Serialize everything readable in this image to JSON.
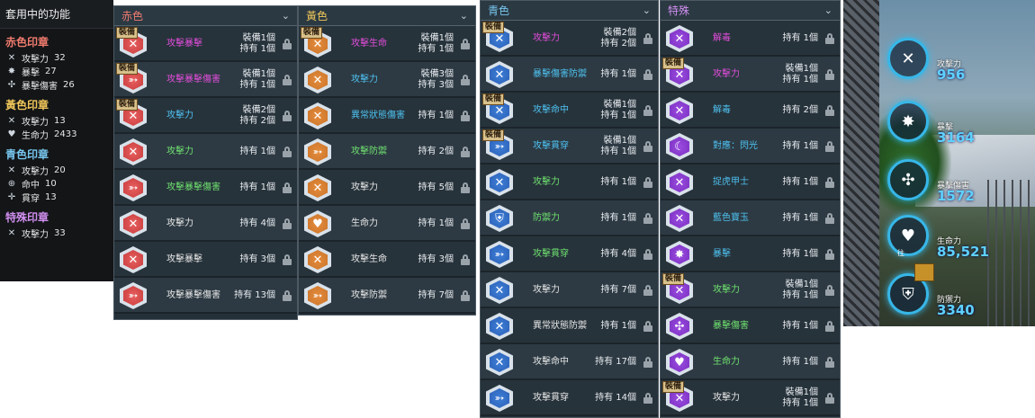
{
  "summary": {
    "title": "套用中的功能",
    "groups": [
      {
        "name": "赤色印章",
        "color": "#f07b6e",
        "items": [
          {
            "icon": "crossed-swords-icon",
            "glyph": "✕",
            "name": "攻擊力",
            "value": "32"
          },
          {
            "icon": "burst-icon",
            "glyph": "✸",
            "name": "暴擊",
            "value": "27"
          },
          {
            "icon": "crit-damage-icon",
            "glyph": "✣",
            "name": "暴擊傷害",
            "value": "26"
          }
        ]
      },
      {
        "name": "黃色印章",
        "color": "#f1c75a",
        "items": [
          {
            "icon": "crossed-swords-icon",
            "glyph": "✕",
            "name": "攻擊力",
            "value": "13"
          },
          {
            "icon": "heart-icon",
            "glyph": "♥",
            "name": "生命力",
            "value": "2433"
          }
        ]
      },
      {
        "name": "青色印章",
        "color": "#77c6ee",
        "items": [
          {
            "icon": "crossed-swords-icon",
            "glyph": "✕",
            "name": "攻擊力",
            "value": "20"
          },
          {
            "icon": "crosshair-icon",
            "glyph": "⊕",
            "name": "命中",
            "value": "10"
          },
          {
            "icon": "pierce-icon",
            "glyph": "✛",
            "name": "貫穿",
            "value": "13"
          }
        ]
      },
      {
        "name": "特殊印章",
        "color": "#d18ff0",
        "items": [
          {
            "icon": "crossed-swords-icon",
            "glyph": "✕",
            "name": "攻擊力",
            "value": "33"
          }
        ]
      }
    ]
  },
  "columns": [
    {
      "title": "赤色",
      "title_color": "#f07b6e",
      "gem_color": "#c73b3b",
      "gem_inner": "#e86060",
      "rows": [
        {
          "equipped": true,
          "name": "攻擊暴擊",
          "name_color": "#e24ddb",
          "equip": "裝備1個",
          "own": "持有 1個",
          "glyph": "✕"
        },
        {
          "equipped": true,
          "name": "攻擊暴擊傷害",
          "name_color": "#e24ddb",
          "equip": "裝備1個",
          "own": "持有 1個",
          "glyph": "➳"
        },
        {
          "equipped": true,
          "name": "攻擊力",
          "name_color": "#4ec1f0",
          "equip": "裝備2個",
          "own": "持有 2個",
          "glyph": "✕"
        },
        {
          "equipped": false,
          "name": "攻擊力",
          "name_color": "#6fe06f",
          "equip": "",
          "own": "持有 1個",
          "glyph": "✕"
        },
        {
          "equipped": false,
          "name": "攻擊暴擊傷害",
          "name_color": "#6fe06f",
          "equip": "",
          "own": "持有 1個",
          "glyph": "➳"
        },
        {
          "equipped": false,
          "name": "攻擊力",
          "name_color": "#e6e6e6",
          "equip": "",
          "own": "持有 4個",
          "glyph": "✕"
        },
        {
          "equipped": false,
          "name": "攻擊暴擊",
          "name_color": "#e6e6e6",
          "equip": "",
          "own": "持有 3個",
          "glyph": "✕"
        },
        {
          "equipped": false,
          "name": "攻擊暴擊傷害",
          "name_color": "#e6e6e6",
          "equip": "",
          "own": "持有 13個",
          "glyph": "➳"
        }
      ]
    },
    {
      "title": "黃色",
      "title_color": "#f1c75a",
      "gem_color": "#c9742a",
      "gem_inner": "#e58c3c",
      "rows": [
        {
          "equipped": true,
          "name": "攻擊生命",
          "name_color": "#e24ddb",
          "equip": "裝備1個",
          "own": "持有 1個",
          "glyph": "✕"
        },
        {
          "equipped": false,
          "name": "攻擊力",
          "name_color": "#4ec1f0",
          "equip": "裝備3個",
          "own": "持有 3個",
          "glyph": "✕"
        },
        {
          "equipped": false,
          "name": "異常狀態傷害",
          "name_color": "#4ec1f0",
          "equip": "",
          "own": "持有 1個",
          "glyph": "✕"
        },
        {
          "equipped": false,
          "name": "攻擊防禦",
          "name_color": "#6fe06f",
          "equip": "",
          "own": "持有 2個",
          "glyph": "➳"
        },
        {
          "equipped": false,
          "name": "攻擊力",
          "name_color": "#e6e6e6",
          "equip": "",
          "own": "持有 5個",
          "glyph": "✕"
        },
        {
          "equipped": false,
          "name": "生命力",
          "name_color": "#e6e6e6",
          "equip": "",
          "own": "持有 1個",
          "glyph": "♥"
        },
        {
          "equipped": false,
          "name": "攻擊生命",
          "name_color": "#e6e6e6",
          "equip": "",
          "own": "持有 3個",
          "glyph": "✕"
        },
        {
          "equipped": false,
          "name": "攻擊防禦",
          "name_color": "#e6e6e6",
          "equip": "",
          "own": "持有 7個",
          "glyph": "➳"
        }
      ]
    },
    {
      "title": "青色",
      "title_color": "#77c6ee",
      "gem_color": "#2a5fb5",
      "gem_inner": "#3f7fd8",
      "rows": [
        {
          "equipped": true,
          "name": "攻擊力",
          "name_color": "#e24ddb",
          "equip": "裝備2個",
          "own": "持有 2個",
          "glyph": "✕"
        },
        {
          "equipped": false,
          "name": "暴擊傷害防禦",
          "name_color": "#4ec1f0",
          "equip": "",
          "own": "持有 1個",
          "glyph": "✕"
        },
        {
          "equipped": true,
          "name": "攻擊命中",
          "name_color": "#4ec1f0",
          "equip": "裝備1個",
          "own": "持有 1個",
          "glyph": "✕"
        },
        {
          "equipped": true,
          "name": "攻擊貫穿",
          "name_color": "#4ec1f0",
          "equip": "裝備1個",
          "own": "持有 1個",
          "glyph": "➳"
        },
        {
          "equipped": false,
          "name": "攻擊力",
          "name_color": "#6fe06f",
          "equip": "",
          "own": "持有 1個",
          "glyph": "✕"
        },
        {
          "equipped": false,
          "name": "防禦力",
          "name_color": "#6fe06f",
          "equip": "",
          "own": "持有 1個",
          "glyph": "⛨"
        },
        {
          "equipped": false,
          "name": "攻擊貫穿",
          "name_color": "#6fe06f",
          "equip": "",
          "own": "持有 4個",
          "glyph": "➳"
        },
        {
          "equipped": false,
          "name": "攻擊力",
          "name_color": "#e6e6e6",
          "equip": "",
          "own": "持有 7個",
          "glyph": "✕"
        },
        {
          "equipped": false,
          "name": "異常狀態防禦",
          "name_color": "#e6e6e6",
          "equip": "",
          "own": "持有 1個",
          "glyph": "✕"
        },
        {
          "equipped": false,
          "name": "攻擊命中",
          "name_color": "#e6e6e6",
          "equip": "",
          "own": "持有 17個",
          "glyph": "✕"
        },
        {
          "equipped": false,
          "name": "攻擊貫穿",
          "name_color": "#e6e6e6",
          "equip": "",
          "own": "持有 14個",
          "glyph": "➳"
        }
      ]
    },
    {
      "title": "特殊",
      "title_color": "#d18ff0",
      "gem_color": "#7a2fc0",
      "gem_inner": "#9a4ce0",
      "rows": [
        {
          "equipped": false,
          "name": "解毒",
          "name_color": "#e24ddb",
          "equip": "",
          "own": "持有 1個",
          "glyph": "✕"
        },
        {
          "equipped": true,
          "name": "攻擊力",
          "name_color": "#e24ddb",
          "equip": "裝備1個",
          "own": "持有 1個",
          "glyph": "✕"
        },
        {
          "equipped": false,
          "name": "解毒",
          "name_color": "#4ec1f0",
          "equip": "",
          "own": "持有 2個",
          "glyph": "✕"
        },
        {
          "equipped": false,
          "name": "對應：閃光",
          "name_color": "#4ec1f0",
          "equip": "",
          "own": "持有 1個",
          "glyph": "☾"
        },
        {
          "equipped": false,
          "name": "捉虎甲士",
          "name_color": "#4ec1f0",
          "equip": "",
          "own": "持有 1個",
          "glyph": "✕"
        },
        {
          "equipped": false,
          "name": "藍色寶玉",
          "name_color": "#4ec1f0",
          "equip": "",
          "own": "持有 1個",
          "glyph": "✕"
        },
        {
          "equipped": false,
          "name": "暴擊",
          "name_color": "#4ec1f0",
          "equip": "",
          "own": "持有 1個",
          "glyph": "✸"
        },
        {
          "equipped": true,
          "name": "攻擊力",
          "name_color": "#6fe06f",
          "equip": "裝備1個",
          "own": "持有 1個",
          "glyph": "✕"
        },
        {
          "equipped": false,
          "name": "暴擊傷害",
          "name_color": "#6fe06f",
          "equip": "",
          "own": "持有 1個",
          "glyph": "✣"
        },
        {
          "equipped": false,
          "name": "生命力",
          "name_color": "#6fe06f",
          "equip": "",
          "own": "持有 1個",
          "glyph": "♥"
        },
        {
          "equipped": true,
          "name": "攻擊力",
          "name_color": "#e6e6e6",
          "equip": "裝備1個",
          "own": "持有 1個",
          "glyph": "✕"
        }
      ]
    }
  ],
  "equipped_badge": "裝備",
  "stats": [
    {
      "icon": "crossed-swords-icon",
      "glyph": "✕",
      "label": "攻擊力",
      "value": "956"
    },
    {
      "icon": "burst-icon",
      "glyph": "✸",
      "label": "暴擊",
      "value": "3164"
    },
    {
      "icon": "crit-damage-icon",
      "glyph": "✣",
      "label": "暴擊傷害",
      "value": "1572"
    },
    {
      "icon": "heart-icon",
      "glyph": "♥",
      "label": "生命力",
      "value": "85,521"
    },
    {
      "icon": "shield-icon",
      "glyph": "⛨",
      "label": "防禦力",
      "value": "3340"
    }
  ],
  "side_label": "往"
}
